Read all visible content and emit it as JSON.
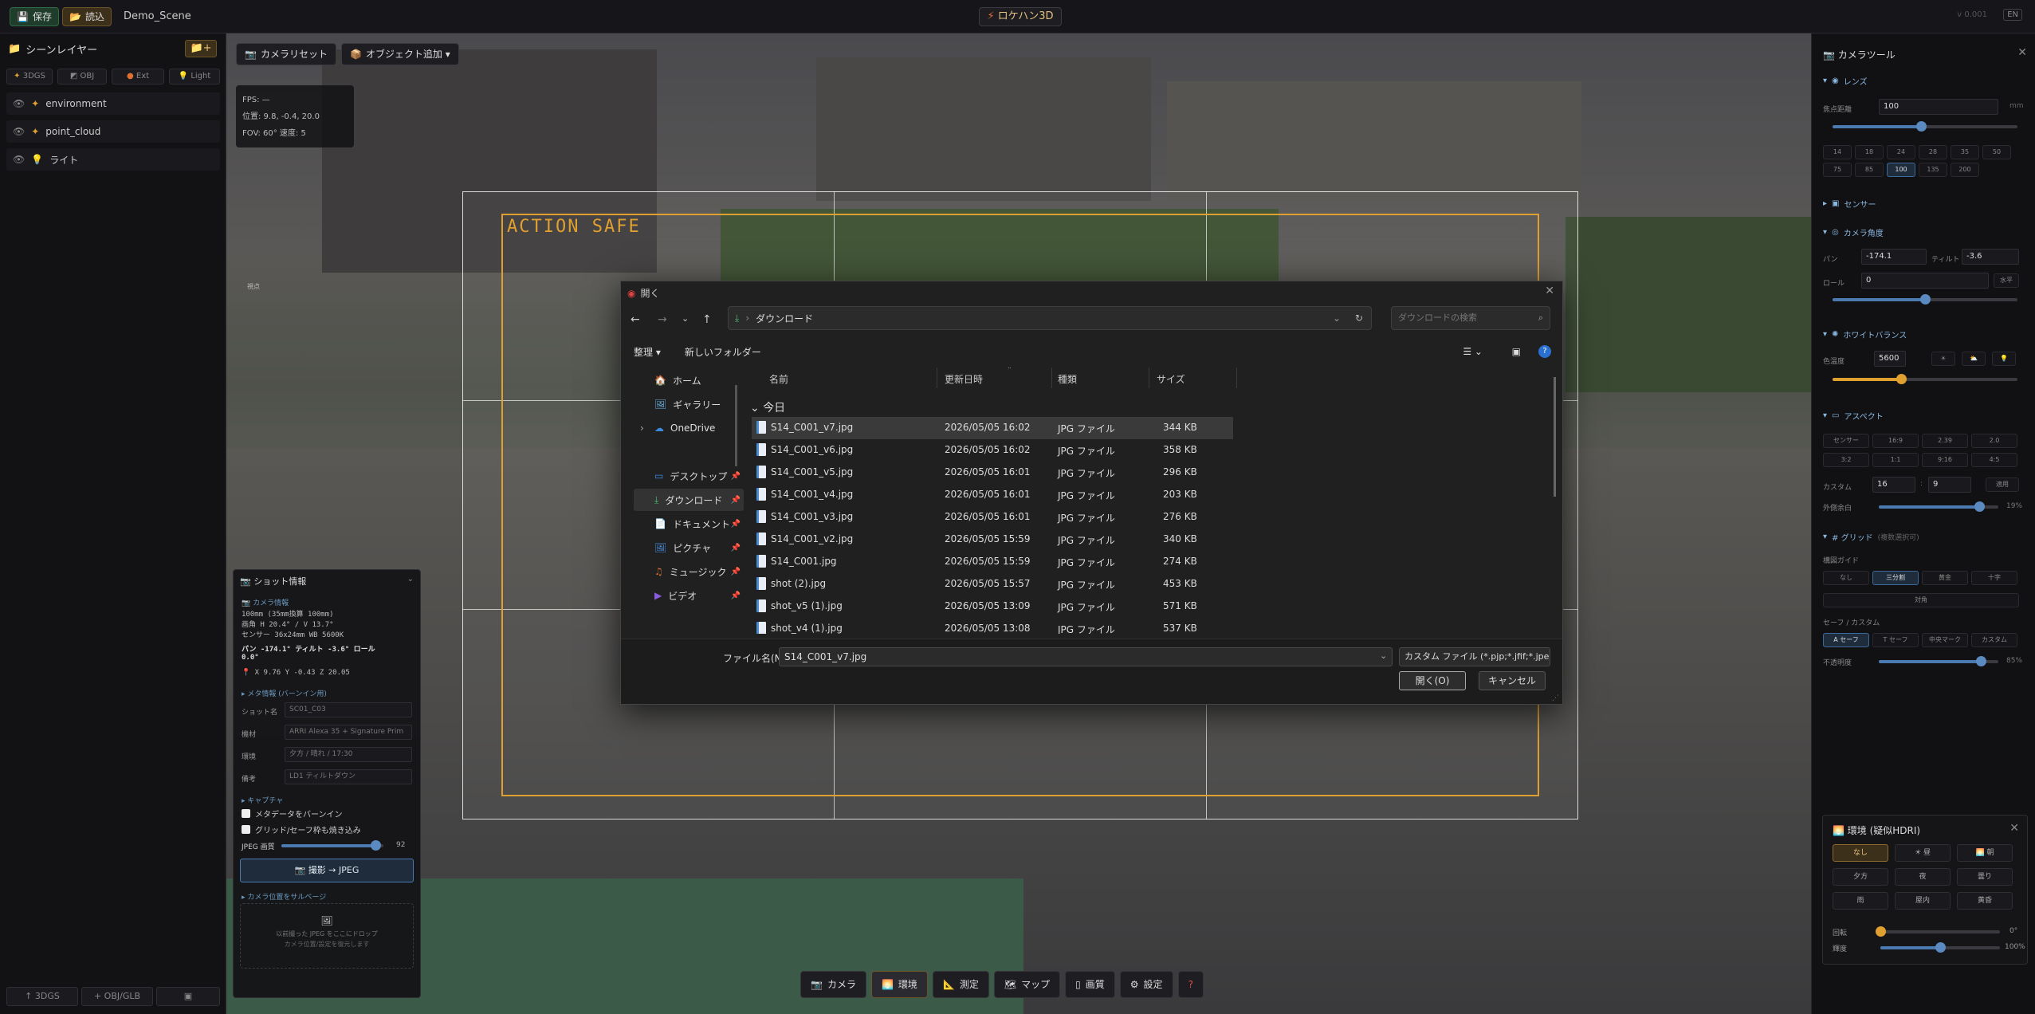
{
  "topbar": {
    "save_label": "保存",
    "load_label": "読込",
    "scene_name": "Demo_Scene",
    "app_title": "ロケハン3D",
    "version": "v 0.001",
    "lang": "EN"
  },
  "left_panel": {
    "title": "シーンレイヤー",
    "add_label": "+",
    "tabs": [
      "3DGS",
      "OBJ",
      "Ext",
      "Light"
    ],
    "layers": [
      "environment",
      "point_cloud",
      "ライト"
    ],
    "bottom_buttons": [
      "↑ 3DGS",
      "+ OBJ/GLB",
      "▣"
    ]
  },
  "viewport": {
    "camera_reset": "カメラリセット",
    "add_object": "オブジェクト追加 ▾",
    "hud": {
      "fps": "FPS: —",
      "position": "位置: 9.8, -0.4, 20.0",
      "fov": "FOV: 60°  速度: 5"
    },
    "safe_label": "ACTION SAFE",
    "tiny_label": "視点"
  },
  "shot_panel": {
    "title": "ショット情報",
    "section_camera": "カメラ情報",
    "line1": "100mm (35mm換算 100mm)",
    "line2": "画角 H 20.4° / V 13.7°",
    "line3": "センサー 36x24mm WB 5600K",
    "line4": "パン -174.1° ティルト -3.6° ロール",
    "line5": "0.0°",
    "line6": "X 9.76  Y -0.43  Z 20.05",
    "section_meta": "メタ情報 (バーンイン用)",
    "fields": [
      {
        "label": "ショット名",
        "value": "SC01_C03"
      },
      {
        "label": "機材",
        "value": "ARRI Alexa 35 + Signature Prim"
      },
      {
        "label": "環境",
        "value": "夕方 / 晴れ / 17:30"
      },
      {
        "label": "備考",
        "value": "LD1 ティルトダウン"
      }
    ],
    "section_capture": "キャプチャ",
    "check_burn": "メタデータをバーンイン",
    "check_grid": "グリッド/セーフ枠も焼き込み",
    "jpeg_label": "JPEG 画質",
    "jpeg_value": "92",
    "jpeg_quality": 0.92,
    "capture_button": "撮影 → JPEG",
    "section_restore": "カメラ位置をサルベージ",
    "drop_text1": "以前撮った JPEG をここにドロップ",
    "drop_text2": "カメラ位置/設定を復元します"
  },
  "bottom_toolbar": [
    "カメラ",
    "環境",
    "測定",
    "マップ",
    "画質",
    "設定",
    "?"
  ],
  "right_panel": {
    "title": "カメラツール",
    "lens_section": "レンズ",
    "focal_label": "焦点距離",
    "focal_value": "100",
    "focal_unit": "mm",
    "focal_chips": [
      "14",
      "18",
      "24",
      "28",
      "35",
      "50",
      "75",
      "85",
      "100",
      "135",
      "200"
    ],
    "focal_selected": "100",
    "focal_slider": 0.48,
    "sensor_section": "センサー",
    "angle_section": "カメラ角度",
    "pan_label": "パン",
    "pan_value": "-174.1",
    "tilt_label": "ティルト",
    "tilt_value": "-3.6",
    "roll_label": "ロール",
    "roll_value": "0",
    "level_button": "水平",
    "roll_slider": 0.5,
    "wb_section": "ホワイトバランス",
    "temp_label": "色温度",
    "temp_value": "5600",
    "temp_slider": 0.37,
    "aspect_section": "アスペクト",
    "aspect_chips": [
      "センサー",
      "16:9",
      "2.39",
      "2.0",
      "3:2",
      "1:1",
      "9:16",
      "4:5"
    ],
    "custom_label": "カスタム",
    "custom_w": "16",
    "custom_h": "9",
    "apply_label": "適用",
    "outer_label": "外側余白",
    "outer_value": "19%",
    "outer_slider": 0.84,
    "grid_section": "# グリッド",
    "grid_hint": "(複数選択可)",
    "comp_label": "構図ガイド",
    "comp_chips": [
      "なし",
      "三分割",
      "黄金",
      "十字"
    ],
    "comp_selected": "三分割",
    "diag_label": "対角",
    "safe_label": "セーフ / カスタム",
    "safe_chips": [
      "A セーフ",
      "T セーフ",
      "中央マーク",
      "カスタム"
    ],
    "safe_selected": "A セーフ",
    "opacity_label": "不透明度",
    "opacity_value": "85%",
    "opacity_slider": 0.85
  },
  "env_panel": {
    "title": "環境 (疑似HDRI)",
    "buttons": [
      "なし",
      "☀ 昼",
      "🌅 朝",
      "夕方",
      "夜",
      "曇り",
      "雨",
      "屋内",
      "黄昏"
    ],
    "selected": "なし",
    "rotate_label": "回転",
    "rotate_value": "0°",
    "rotate_slider": 0.0,
    "bright_label": "輝度",
    "bright_value": "100%",
    "bright_slider": 0.5
  },
  "dialog": {
    "title": "開く",
    "address": "ダウンロード",
    "search_placeholder": "ダウンロードの検索",
    "organize": "整理 ▾",
    "new_folder": "新しいフォルダー",
    "nav": [
      "ホーム",
      "ギャラリー",
      "OneDrive",
      "デスクトップ",
      "ダウンロード",
      "ドキュメント",
      "ピクチャ",
      "ミュージック",
      "ビデオ"
    ],
    "nav_selected": "ダウンロード",
    "columns": [
      "名前",
      "更新日時",
      "種類",
      "サイズ"
    ],
    "group": "今日",
    "files": [
      {
        "name": "S14_C001_v7.jpg",
        "date": "2026/05/05 16:02",
        "type": "JPG ファイル",
        "size": "344 KB"
      },
      {
        "name": "S14_C001_v6.jpg",
        "date": "2026/05/05 16:02",
        "type": "JPG ファイル",
        "size": "358 KB"
      },
      {
        "name": "S14_C001_v5.jpg",
        "date": "2026/05/05 16:01",
        "type": "JPG ファイル",
        "size": "296 KB"
      },
      {
        "name": "S14_C001_v4.jpg",
        "date": "2026/05/05 16:01",
        "type": "JPG ファイル",
        "size": "203 KB"
      },
      {
        "name": "S14_C001_v3.jpg",
        "date": "2026/05/05 16:01",
        "type": "JPG ファイル",
        "size": "276 KB"
      },
      {
        "name": "S14_C001_v2.jpg",
        "date": "2026/05/05 15:59",
        "type": "JPG ファイル",
        "size": "340 KB"
      },
      {
        "name": "S14_C001.jpg",
        "date": "2026/05/05 15:59",
        "type": "JPG ファイル",
        "size": "274 KB"
      },
      {
        "name": "shot (2).jpg",
        "date": "2026/05/05 15:57",
        "type": "JPG ファイル",
        "size": "453 KB"
      },
      {
        "name": "shot_v5 (1).jpg",
        "date": "2026/05/05 13:09",
        "type": "JPG ファイル",
        "size": "571 KB"
      },
      {
        "name": "shot_v4 (1).jpg",
        "date": "2026/05/05 13:08",
        "type": "JPG ファイル",
        "size": "537 KB"
      }
    ],
    "filename_label": "ファイル名(N):",
    "filename_value": "S14_C001_v7.jpg",
    "filter_value": "カスタム ファイル (*.pjp;*.jfif;*.jpe;*",
    "open_button": "開く(O)",
    "cancel_button": "キャンセル"
  }
}
